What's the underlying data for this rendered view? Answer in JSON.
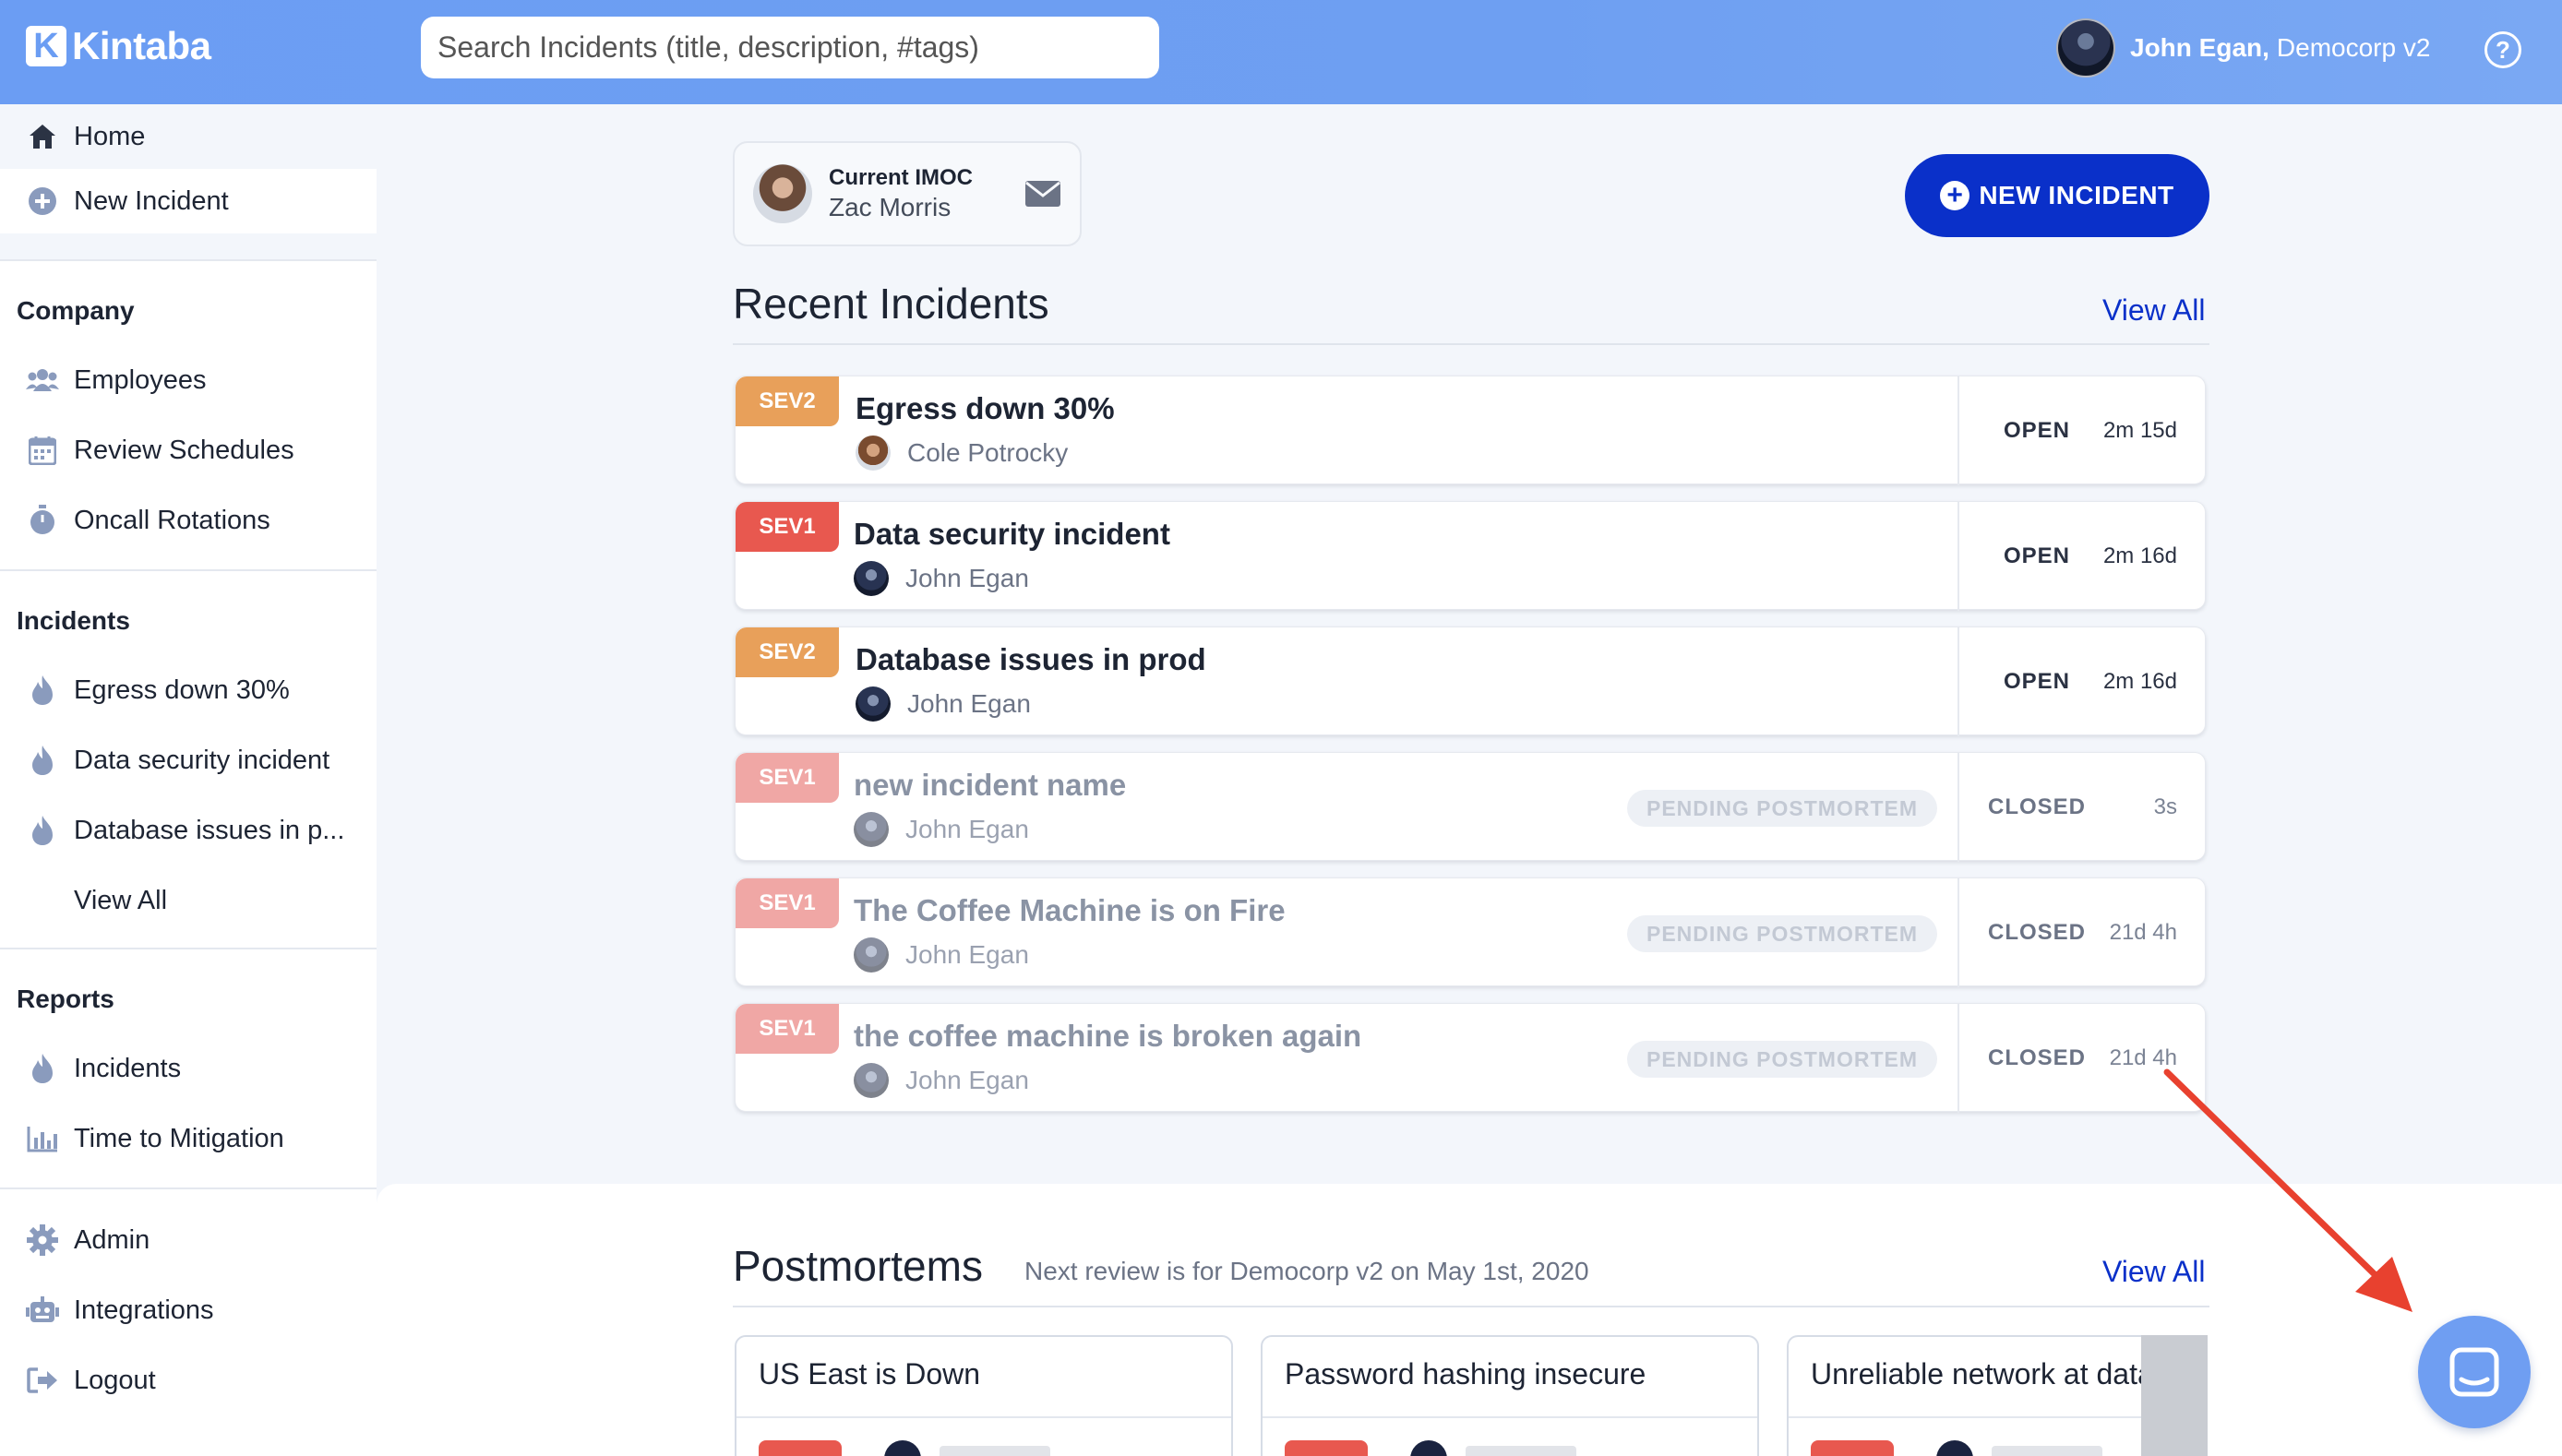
{
  "app": {
    "logo_letter": "K",
    "name": "Kintaba"
  },
  "search": {
    "placeholder": "Search Incidents (title, description, #tags)"
  },
  "user": {
    "name": "John Egan,",
    "org": "Democorp v2",
    "help": "?"
  },
  "sidebar": {
    "home": "Home",
    "new_incident": "New Incident",
    "company": {
      "heading": "Company",
      "items": [
        "Employees",
        "Review Schedules",
        "Oncall Rotations"
      ]
    },
    "incidents": {
      "heading": "Incidents",
      "items": [
        "Egress down 30%",
        "Data security incident",
        "Database issues in p..."
      ],
      "view_all": "View All"
    },
    "reports": {
      "heading": "Reports",
      "items": [
        "Incidents",
        "Time to Mitigation"
      ]
    },
    "bottom": [
      "Admin",
      "Integrations",
      "Logout"
    ]
  },
  "imoc": {
    "label": "Current IMOC",
    "name": "Zac Morris"
  },
  "new_incident_button": "NEW INCIDENT",
  "recent": {
    "title": "Recent Incidents",
    "view_all": "View All",
    "incidents": [
      {
        "sev": "SEV2",
        "title": "Egress down 30%",
        "owner": "Cole Potrocky",
        "status": "OPEN",
        "duration": "2m 15d",
        "tag": ""
      },
      {
        "sev": "SEV1",
        "title": "Data security incident",
        "owner": "John Egan",
        "status": "OPEN",
        "duration": "2m 16d",
        "tag": ""
      },
      {
        "sev": "SEV2",
        "title": "Database issues in prod",
        "owner": "John Egan",
        "status": "OPEN",
        "duration": "2m 16d",
        "tag": ""
      },
      {
        "sev": "SEV1",
        "title": "new incident name",
        "owner": "John Egan",
        "status": "CLOSED",
        "duration": "3s",
        "tag": "PENDING POSTMORTEM"
      },
      {
        "sev": "SEV1",
        "title": "The Coffee Machine is on Fire",
        "owner": "John Egan",
        "status": "CLOSED",
        "duration": "21d 4h",
        "tag": "PENDING POSTMORTEM"
      },
      {
        "sev": "SEV1",
        "title": "the coffee machine is broken again",
        "owner": "John Egan",
        "status": "CLOSED",
        "duration": "21d 4h",
        "tag": "PENDING POSTMORTEM"
      }
    ]
  },
  "postmortems": {
    "title": "Postmortems",
    "subtitle": "Next review is for Democorp v2 on May 1st, 2020",
    "view_all": "View All",
    "cards": [
      "US East is Down",
      "Password hashing insecure",
      "Unreliable network at datacen"
    ]
  },
  "colors": {
    "header": "#6b9df3",
    "primary": "#0a30c9",
    "sev1": "#e8584f",
    "sev2": "#e8a05a",
    "annotation_arrow": "#e8412f"
  }
}
